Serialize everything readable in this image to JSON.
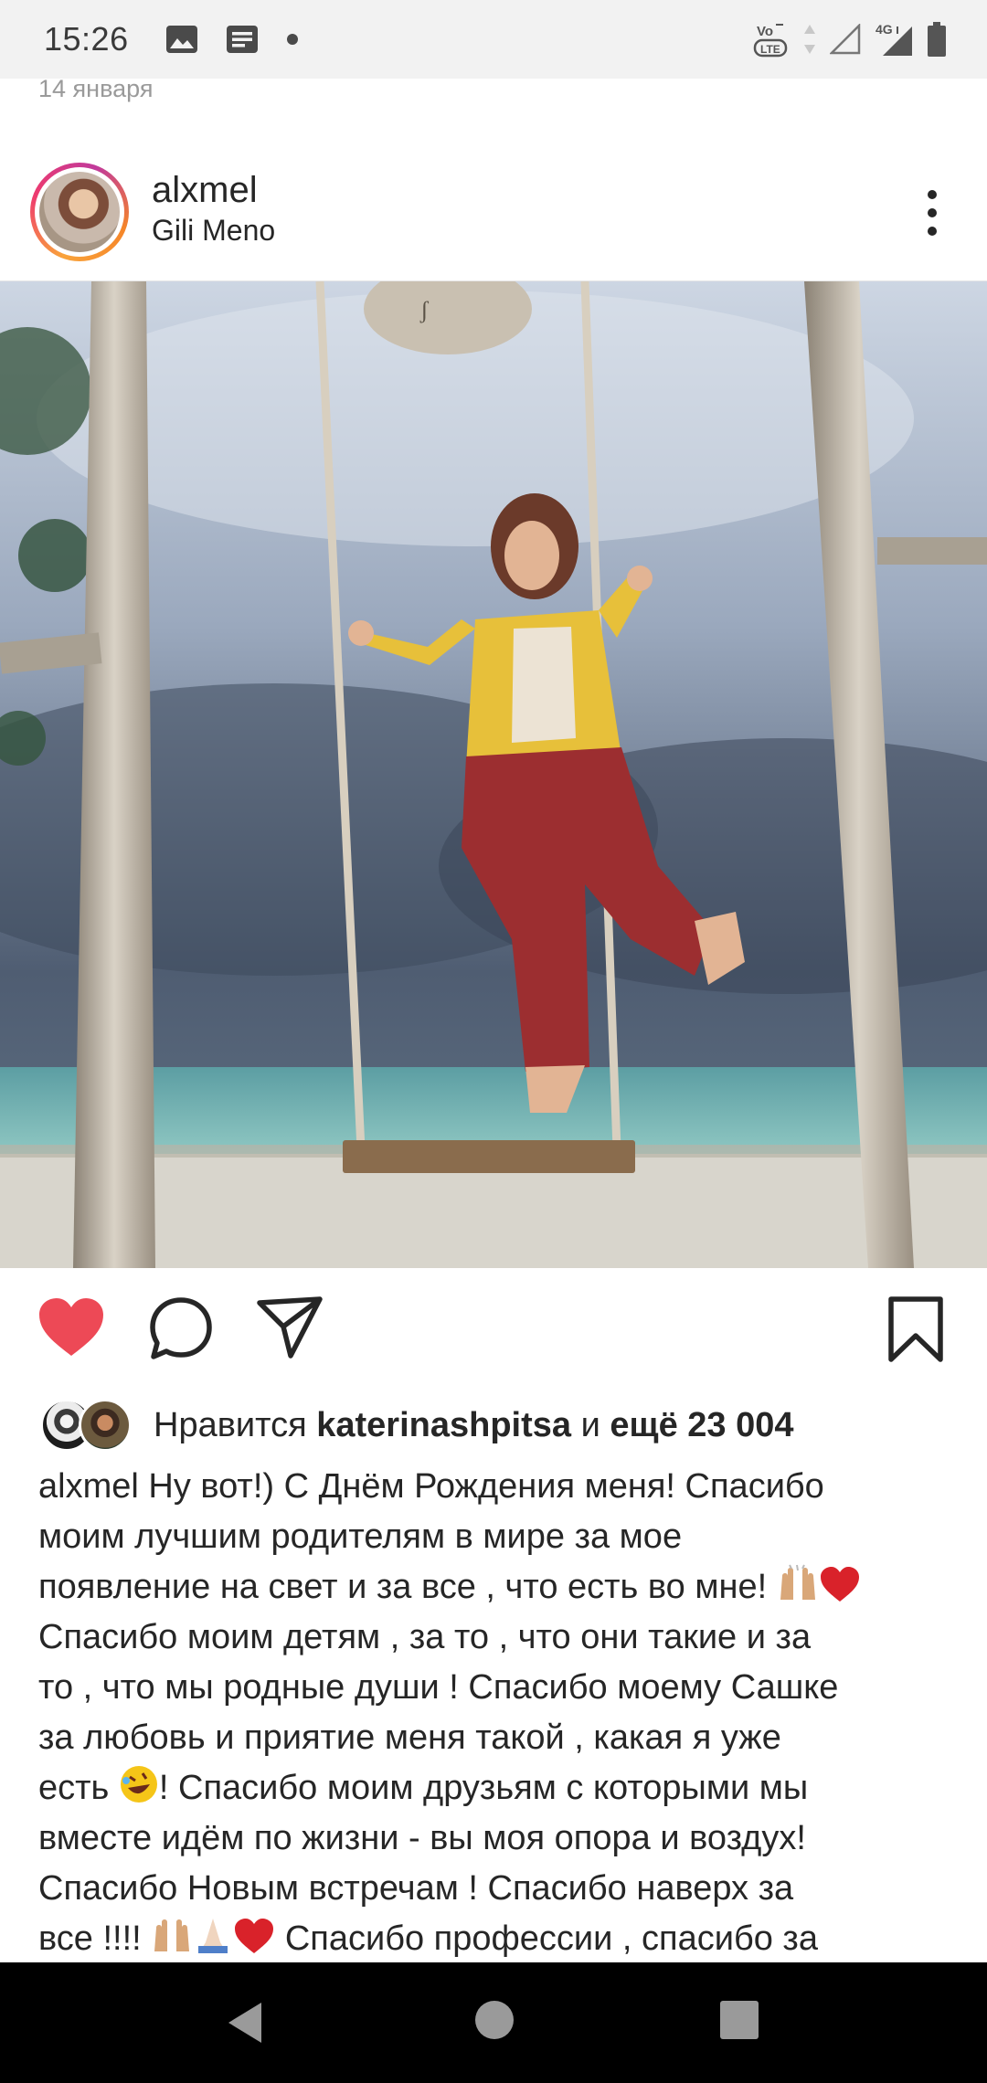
{
  "status_bar": {
    "time": "15:26",
    "left_icons": [
      "image-icon",
      "message-icon",
      "dot-icon"
    ],
    "right_icons": [
      "volte-icon",
      "data-arrows-icon",
      "signal-empty-icon",
      "signal-4g-icon",
      "battery-icon"
    ],
    "network_label": "4G",
    "volte_label": "VoLTE"
  },
  "post": {
    "date": "14 января",
    "username": "alxmel",
    "location": "Gili Meno",
    "liked": true,
    "likes": {
      "prefix": "Нравится",
      "user": "katerinashpitsa",
      "middle": "и",
      "count_text": "ещё 23 004"
    },
    "caption": {
      "username": "alxmel",
      "line1": "Ну вот!) С Днём Рождения меня! Спасибо",
      "line2": "моим лучшим родителям в мире за мое",
      "line3": "появление на свет и за все , что есть во мне!",
      "line4": "Спасибо моим детям , за то , что они такие и за",
      "line5": "то , что мы родные души ! Спасибо моему Сашке",
      "line6": "за любовь и приятие меня такой , какая я уже",
      "line7a": "есть",
      "line7b": "! Спасибо моим друзьям с которыми мы",
      "line8": "вместе идём по жизни - вы моя опора и воздух!",
      "line9": "Спасибо Новым встречам ! Спасибо наверх за",
      "line10a": "все !!!!",
      "line10b": "Спасибо профессии , спасибо за"
    }
  },
  "colors": {
    "like_red": "#ed4956",
    "text": "#262626",
    "muted": "#9a9a9a"
  }
}
